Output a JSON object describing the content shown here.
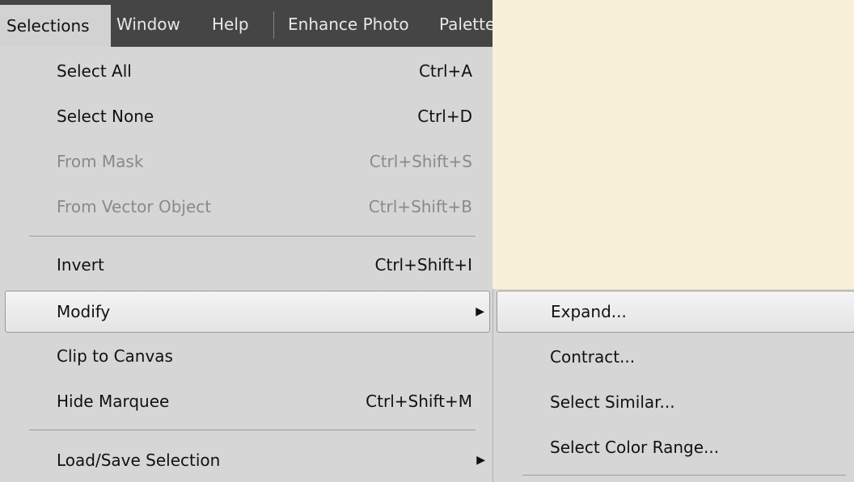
{
  "menubar": {
    "items": [
      {
        "label": "Selections"
      },
      {
        "label": "Window"
      },
      {
        "label": "Help"
      },
      {
        "label": "Enhance Photo"
      },
      {
        "label": "Palette"
      }
    ]
  },
  "menu": {
    "items": [
      {
        "label": "Select All",
        "shortcut": "Ctrl+A"
      },
      {
        "label": "Select None",
        "shortcut": "Ctrl+D"
      },
      {
        "label": "From Mask",
        "shortcut": "Ctrl+Shift+S"
      },
      {
        "label": "From Vector Object",
        "shortcut": "Ctrl+Shift+B"
      },
      {
        "label": "Invert",
        "shortcut": "Ctrl+Shift+I"
      },
      {
        "label": "Modify",
        "shortcut": ""
      },
      {
        "label": "Clip to Canvas",
        "shortcut": ""
      },
      {
        "label": "Hide Marquee",
        "shortcut": "Ctrl+Shift+M"
      },
      {
        "label": "Load/Save Selection",
        "shortcut": ""
      }
    ]
  },
  "submenu": {
    "items": [
      {
        "label": "Expand..."
      },
      {
        "label": "Contract..."
      },
      {
        "label": "Select Similar..."
      },
      {
        "label": "Select Color Range..."
      }
    ]
  },
  "icons": {
    "submenu_arrow": "submenu-arrow-icon"
  },
  "colors": {
    "menubar_bg": "#454545",
    "menu_bg": "#d6d6d6",
    "workspace_bg": "#f8f0d8",
    "disabled_text": "#8a8a8a"
  }
}
